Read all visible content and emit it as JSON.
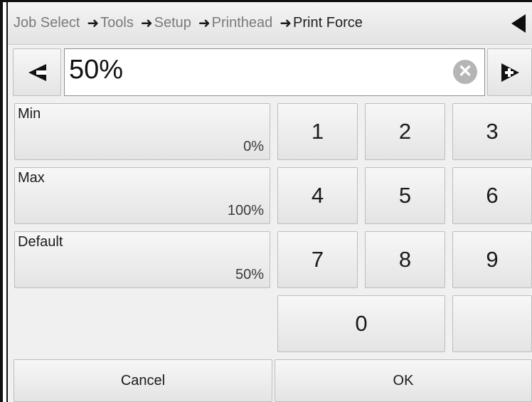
{
  "breadcrumb": {
    "items": [
      "Job Select",
      "Tools",
      "Setup",
      "Printhead"
    ],
    "current": "Print Force",
    "separator": "➜"
  },
  "header": {
    "back_icon": "back-triangle-icon"
  },
  "editor": {
    "value": "50%",
    "decrement_icon": "left-arrow-icon",
    "increment_icon": "right-arrow-plus-icon",
    "clear_icon": "clear-circle-icon",
    "clear_glyph": "✕"
  },
  "presets": [
    {
      "label": "Min",
      "value": "0%"
    },
    {
      "label": "Max",
      "value": "100%"
    },
    {
      "label": "Default",
      "value": "50%"
    }
  ],
  "keypad": [
    "1",
    "2",
    "3",
    "4",
    "5",
    "6",
    "7",
    "8",
    "9",
    "0"
  ],
  "footer": {
    "cancel_label": "Cancel",
    "ok_label": "OK"
  }
}
